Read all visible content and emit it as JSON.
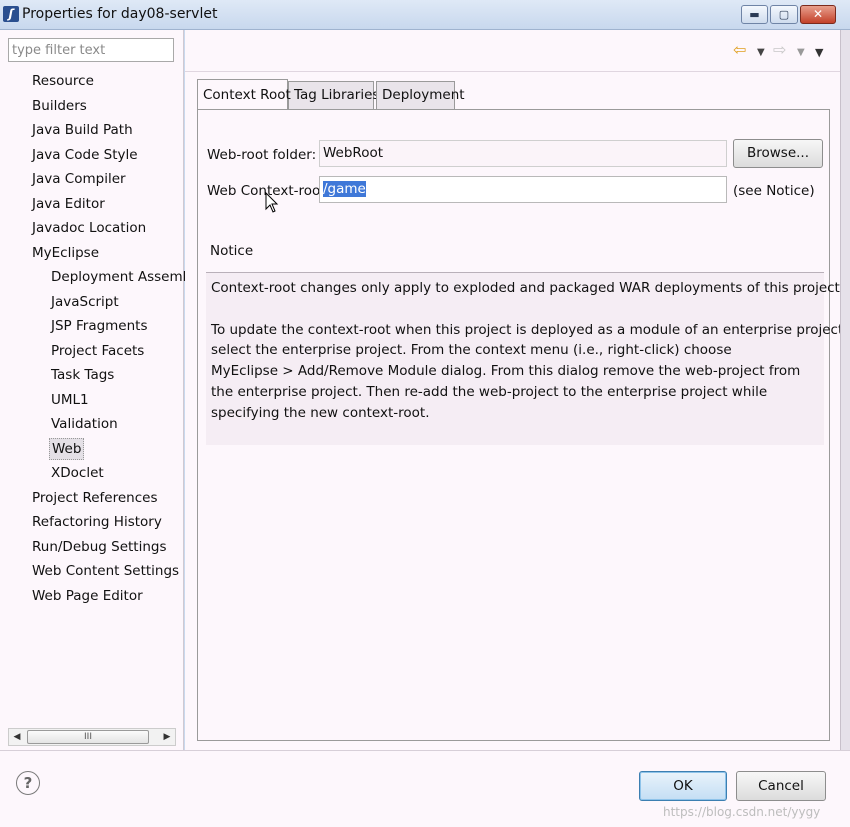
{
  "window": {
    "title": "Properties for day08-servlet",
    "min_label": "▬",
    "max_label": "▢",
    "close_label": "✕"
  },
  "filter": {
    "placeholder": "type filter text"
  },
  "tree": {
    "items": [
      {
        "label": "Resource",
        "level": 0
      },
      {
        "label": "Builders",
        "level": 0
      },
      {
        "label": "Java Build Path",
        "level": 0
      },
      {
        "label": "Java Code Style",
        "level": 0
      },
      {
        "label": "Java Compiler",
        "level": 0
      },
      {
        "label": "Java Editor",
        "level": 0
      },
      {
        "label": "Javadoc Location",
        "level": 0
      },
      {
        "label": "MyEclipse",
        "level": 0
      },
      {
        "label": "Deployment Assembl",
        "level": 1
      },
      {
        "label": "JavaScript",
        "level": 1
      },
      {
        "label": "JSP Fragments",
        "level": 1
      },
      {
        "label": "Project Facets",
        "level": 1
      },
      {
        "label": "Task Tags",
        "level": 1
      },
      {
        "label": "UML1",
        "level": 1
      },
      {
        "label": "Validation",
        "level": 1
      },
      {
        "label": "Web",
        "level": 1,
        "selected": true
      },
      {
        "label": "XDoclet",
        "level": 1
      },
      {
        "label": "Project References",
        "level": 0
      },
      {
        "label": "Refactoring History",
        "level": 0
      },
      {
        "label": "Run/Debug Settings",
        "level": 0
      },
      {
        "label": "Web Content Settings",
        "level": 0
      },
      {
        "label": "Web Page Editor",
        "level": 0
      }
    ],
    "scroll_thumb_label": "III"
  },
  "nav": {
    "back_icon": "back-arrow-icon",
    "forward_icon": "forward-arrow-icon"
  },
  "tabs": [
    {
      "label": "Context Root",
      "active": true
    },
    {
      "label": "Tag Libraries",
      "active": false
    },
    {
      "label": "Deployment",
      "active": false
    }
  ],
  "form": {
    "web_root_label": "Web-root folder:",
    "web_root_value": "WebRoot",
    "browse_label": "Browse...",
    "context_root_label": "Web Context-root:",
    "context_root_value": "/game",
    "see_notice": "(see Notice)"
  },
  "notice": {
    "heading": "Notice",
    "lines": [
      "Context-root changes only apply to exploded and packaged WAR deployments of this project.",
      "",
      "To update the context-root when this project is deployed as a module of an enterprise project",
      "select the enterprise project. From the context menu (i.e., right-click) choose",
      "MyEclipse > Add/Remove Module dialog. From this dialog remove the web-project from",
      "the enterprise project. Then re-add the web-project to the enterprise project while",
      "specifying the new context-root."
    ]
  },
  "buttons": {
    "ok": "OK",
    "cancel": "Cancel",
    "help": "?"
  },
  "watermark": "https://blog.csdn.net/yygy",
  "colors": {
    "selection": "#3f78d8",
    "background": "#fdf7fc",
    "titlebar": "#c8d8ee"
  }
}
